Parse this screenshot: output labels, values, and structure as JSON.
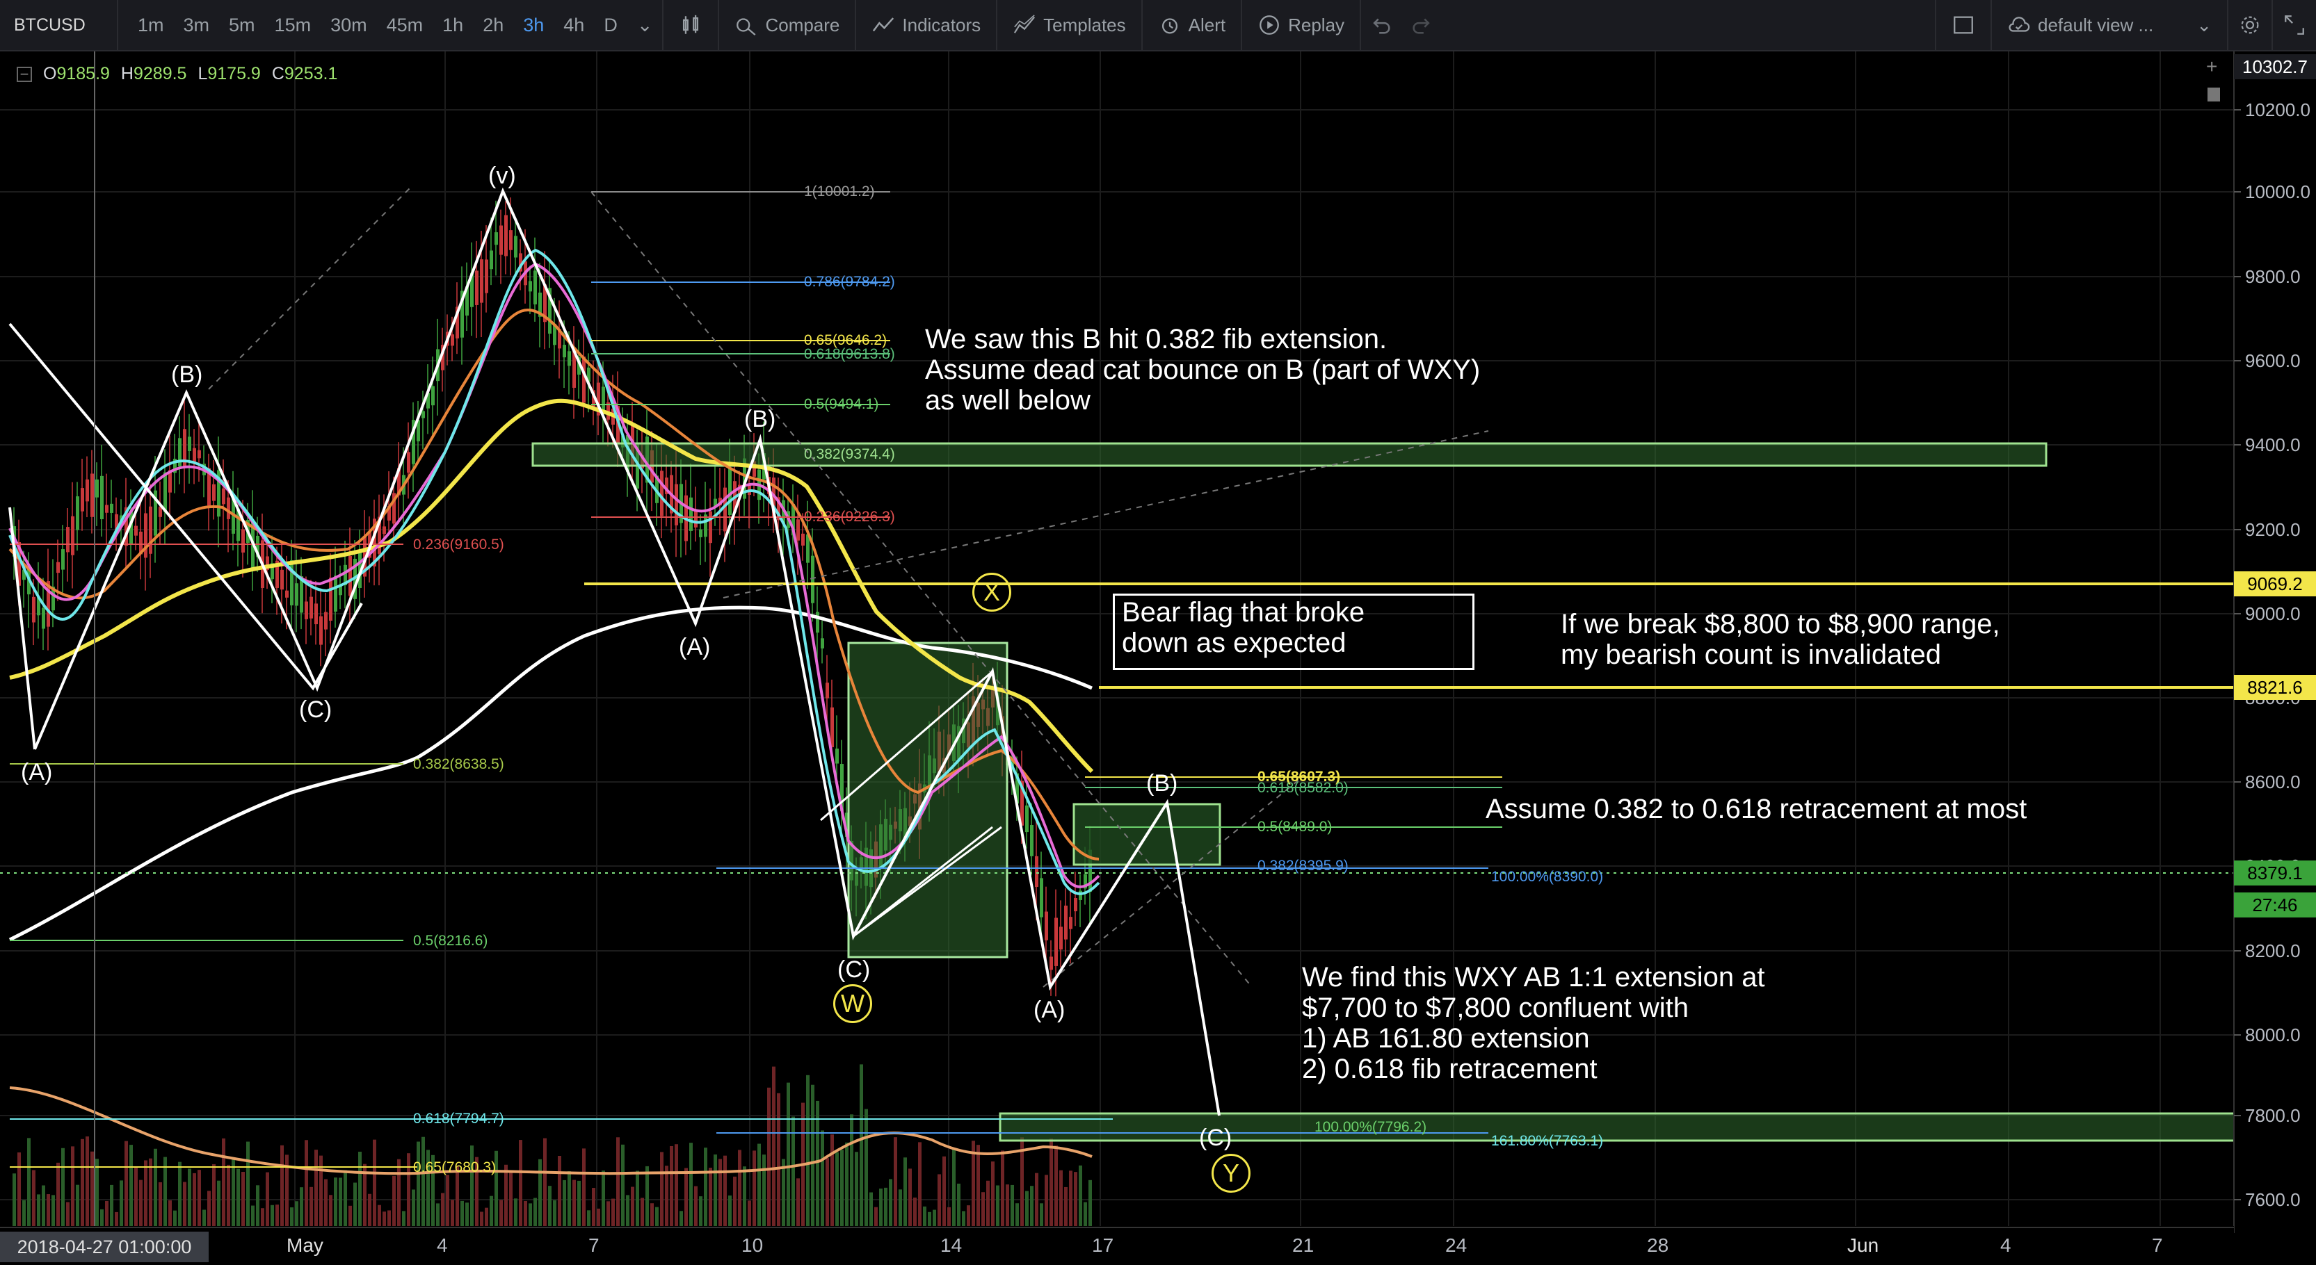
{
  "toolbar": {
    "symbol": "BTCUSD",
    "intervals": [
      "1m",
      "3m",
      "5m",
      "15m",
      "30m",
      "45m",
      "1h",
      "2h",
      "3h",
      "4h",
      "D"
    ],
    "active_interval": "3h",
    "compare": "Compare",
    "indicators": "Indicators",
    "templates": "Templates",
    "alert": "Alert",
    "replay": "Replay",
    "layout": "default view ..."
  },
  "ohlc": {
    "o_label": "O",
    "o": "9185.9",
    "h_label": "H",
    "h": "9289.5",
    "l_label": "L",
    "l": "9175.9",
    "c_label": "C",
    "c": "9253.1"
  },
  "price_axis": {
    "top_label": "10302.7",
    "ticks": [
      "10200.0",
      "10000.0",
      "9800.0",
      "9600.0",
      "9400.0",
      "9200.0",
      "9000.0",
      "8800.0",
      "8600.0",
      "8400.0",
      "8200.0",
      "8000.0",
      "7800.0",
      "7600.0"
    ],
    "marker_9069": "9069.2",
    "marker_8821": "8821.6",
    "current_price": "8379.1",
    "countdown": "27:46"
  },
  "time_axis": {
    "cursor_label": "2018-04-27 01:00:00",
    "ticks": [
      "May",
      "4",
      "7",
      "10",
      "14",
      "17",
      "21",
      "24",
      "28",
      "Jun",
      "4",
      "7"
    ]
  },
  "annotations": {
    "note_b_hit": "We saw this B hit 0.382 fib extension.\nAssume dead cat bounce on B (part of WXY)\nas well below",
    "bear_flag": "Bear flag that broke\ndown as expected",
    "invalidation": "If we break $8,800 to $8,900 range,\nmy bearish count is invalidated",
    "retracement": "Assume 0.382 to 0.618 retracement at most",
    "wxy": "We find this WXY AB 1:1 extension at\n$7,700 to $7,800 confluent with\n1) AB 161.80 extension\n2) 0.618 fib retracement"
  },
  "fib_labels": {
    "f1": "1(10001.2)",
    "f786": "0.786(9784.2)",
    "f65": "0.65(9646.2)",
    "f618": "0.618(9613.8)",
    "f5": "0.5(9494.1)",
    "f382": "0.382(9374.4)",
    "f236": "0.236(9226.3)",
    "f236b": "0.236(9160.5)",
    "f382b": "0.382(8638.5)",
    "f5b": "0.5(8216.6)",
    "f618b": "0.618(7794.7)",
    "f65b": "0.65(7680.3)",
    "g65": "0.65(8607.3)",
    "g618": "0.618(8582.0)",
    "g5": "0.5(8489.0)",
    "g382": "0.382(8395.9)",
    "e100a": "100.00%(8390.0)",
    "e100b": "100.00%(7796.2)",
    "e161": "161.80%(7763.1)"
  },
  "wave_labels": {
    "A1": "(A)",
    "B1": "(B)",
    "C1": "(C)",
    "v": "(v)",
    "A2": "(A)",
    "B2": "(B)",
    "C2": "(C)",
    "W": "W",
    "X": "X",
    "A3": "(A)",
    "B3": "(B)",
    "C3": "(C)",
    "Y": "Y"
  },
  "colors": {
    "background": "#000000",
    "candle_up": "#3fa33f",
    "candle_down": "#c8393b",
    "ma_white": "#ffffff",
    "ma_yellow": "#f3e64a",
    "ma_orange": "#e8853a",
    "ma_pink": "#e86bd6",
    "ma_cyan": "#6fe7ea",
    "zone_fill": "#2f6a2e",
    "accent_blue": "#4e9af1"
  }
}
